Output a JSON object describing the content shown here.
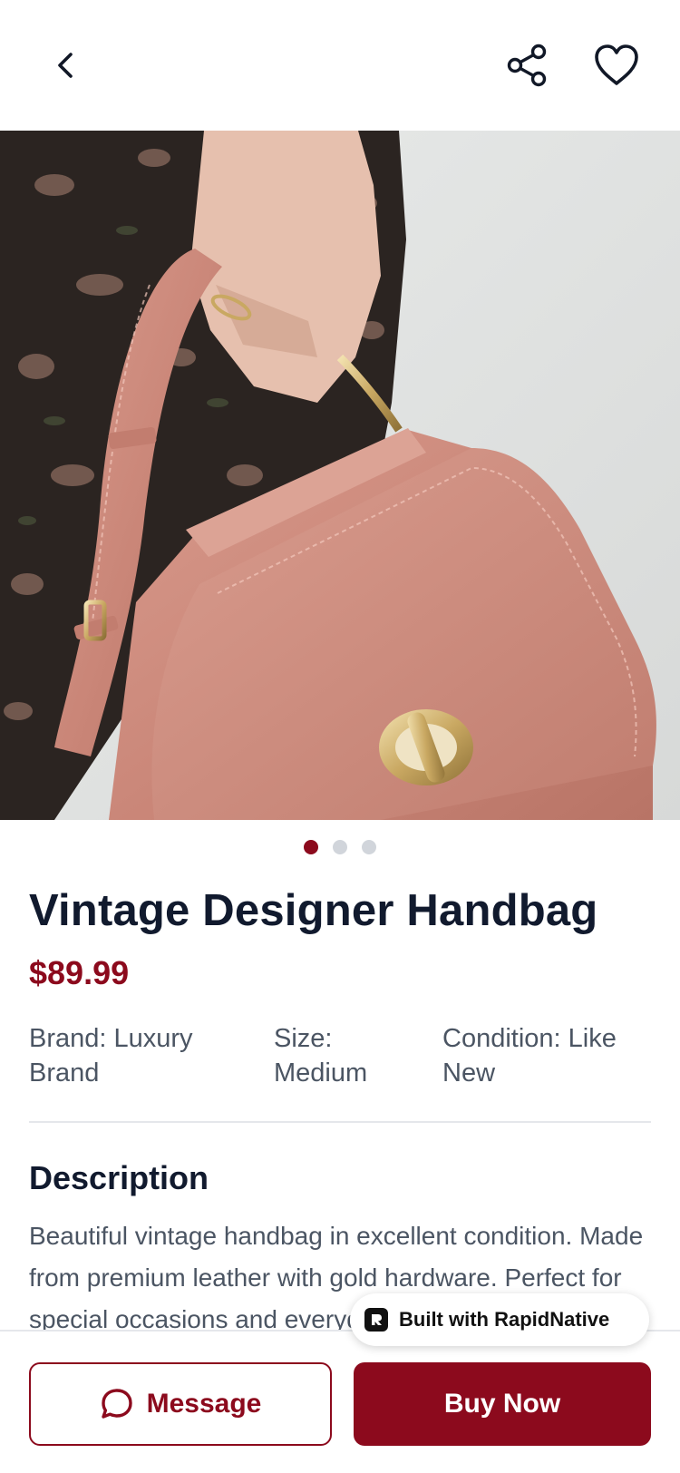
{
  "header": {
    "back_icon": "chevron-left-icon",
    "share_icon": "share-icon",
    "favorite_icon": "heart-icon"
  },
  "gallery": {
    "image_count": 3,
    "active_index": 0,
    "image_subject": "pink leather handbag with gold turn-lock clasp held by hand"
  },
  "product": {
    "title": "Vintage Designer Handbag",
    "price": "$89.99",
    "brand": "Brand: Luxury Brand",
    "size": "Size: Medium",
    "condition": "Condition: Like New"
  },
  "description": {
    "heading": "Description",
    "body": "Beautiful vintage handbag in excellent condition. Made from premium leather with gold hardware. Perfect for special occasions and everyday use."
  },
  "badge": {
    "label": "Built with RapidNative"
  },
  "actions": {
    "message_label": "Message",
    "buy_label": "Buy Now"
  },
  "colors": {
    "accent": "#8c0a1d",
    "title": "#111a2e",
    "body": "#4b5563",
    "dot_inactive": "#d1d5db"
  }
}
